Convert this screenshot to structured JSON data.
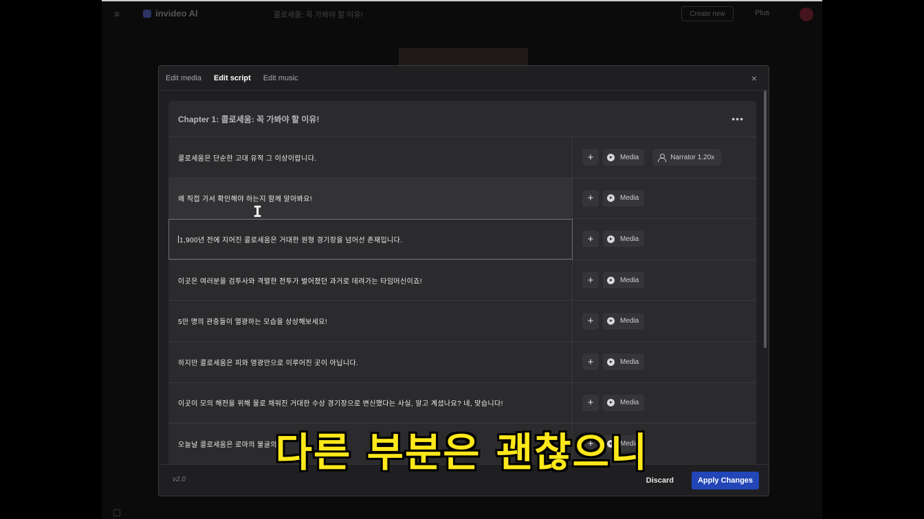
{
  "background_app": {
    "logo_text": "invideo AI",
    "project_title": "콜로세움: 꼭 가봐야 할 이유!",
    "share_label": "Create new",
    "plan_label": "Plus",
    "avatar_letter": "J"
  },
  "modal": {
    "tabs": [
      {
        "label": "Edit media",
        "active": false
      },
      {
        "label": "Edit script",
        "active": true
      },
      {
        "label": "Edit music",
        "active": false
      }
    ],
    "close_glyph": "×",
    "chapter": {
      "title": "Chapter 1: 콜로세움: 꼭 가봐야 할 이유!",
      "more_glyph": "•••"
    },
    "rows": [
      {
        "text": "콜로세움은 단순한 고대 유적 그 이상이랍니다.",
        "media_label": "Media",
        "narrator_label": "Narrator 1.20x"
      },
      {
        "text": "왜 직접 가서 확인해야 하는지 함께 알아봐요!",
        "media_label": "Media"
      },
      {
        "text": "1,900년 전에 지어진 콜로세움은 거대한 원형 경기장을 넘어선 존재입니다.",
        "media_label": "Media"
      },
      {
        "text": "이곳은 여러분을 검투사와 격렬한 전투가 벌어졌던 과거로 데려가는 타임머신이죠!",
        "media_label": "Media"
      },
      {
        "text": "5만 명의 관중들이 열광하는 모습을 상상해보세요!",
        "media_label": "Media"
      },
      {
        "text": "하지만 콜로세움은 피와 영광만으로 이루어진 곳이 아닙니다.",
        "media_label": "Media"
      },
      {
        "text": "이곳이 모의 해전을 위해 물로 채워진 거대한 수상 경기장으로 변신했다는 사실, 알고 계셨나요? 네, 맞습니다!",
        "media_label": "Media"
      },
      {
        "text": "오늘날 콜로세움은 로마의 불굴의",
        "media_label": "Media"
      }
    ],
    "add_glyph": "+",
    "footer": {
      "version": "v2.0",
      "discard_label": "Discard",
      "apply_label": "Apply Changes"
    }
  },
  "subtitle": "다른 부분은 괜찮으니",
  "colors": {
    "accent_button": "#2246b8",
    "subtitle": "#ffe81a",
    "modal_bg": "#1f1f21"
  }
}
